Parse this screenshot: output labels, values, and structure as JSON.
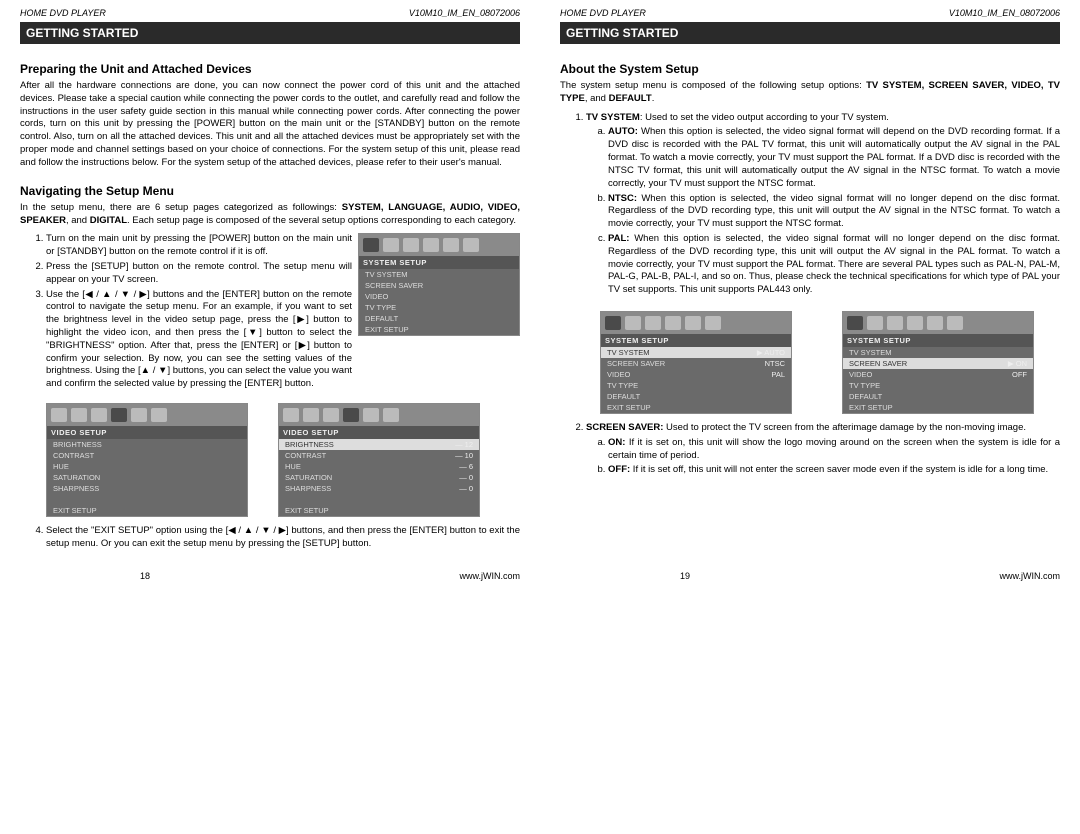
{
  "header": {
    "left": "HOME DVD PLAYER",
    "right": "V10M10_IM_EN_08072006"
  },
  "band": "GETTING STARTED",
  "footer": {
    "site": "www.jWIN.com"
  },
  "left": {
    "h1": "Preparing the Unit and Attached Devices",
    "p1": "After all the hardware connections are done, you can now connect the power cord of this unit and the attached devices. Please take a special caution while connecting the power cords to the outlet, and carefully read and follow the instructions in the user safety guide section in this manual while connecting power cords. After connecting the power cords, turn on this unit by pressing the [POWER] button on the main unit or the [STANDBY] button on the remote control. Also, turn on all the attached devices. This unit and all the attached devices must be appropriately set with the proper mode and channel settings based on your choice of connections. For the system setup of this unit, please read and follow the instructions below. For the system setup of the attached devices, please refer to their user's manual.",
    "h2": "Navigating the Setup Menu",
    "p2a": "In the setup menu, there are 6 setup pages categorized as followings: ",
    "p2b_bold": "SYSTEM, LANGUAGE, AUDIO, VIDEO, SPEAKER",
    "p2c": ", and ",
    "p2d_bold": "DIGITAL",
    "p2e": ". Each setup page is composed of the several setup options corresponding to each category.",
    "li1": "Turn on the main unit by pressing the [POWER] button on the main unit or [STANDBY] button on the remote control if it is off.",
    "li2": "Press the [SETUP] button on the remote control. The setup menu will appear on your TV screen.",
    "li3": "Use the [◀ / ▲ / ▼ / ▶] buttons and the [ENTER] button on the remote control to navigate the setup menu. For an example, if you want to set the brightness level in the video setup page, press the [▶] button to highlight the video icon, and then press the [▼] button to select the \"BRIGHTNESS\" option. After that, press the [ENTER] or [▶] button to confirm your selection. By now, you can see the setting values of the brightness. Using the [▲ / ▼] buttons, you can select the value you want and confirm the selected value by pressing the [ENTER] button.",
    "li4": "Select the \"EXIT SETUP\" option using the [◀ / ▲ / ▼ / ▶] buttons, and then press the [ENTER] button to exit the setup menu. Or you can exit the setup menu by pressing the [SETUP] button.",
    "pageno": "18",
    "shot_system": {
      "title": "SYSTEM SETUP",
      "rows": [
        "TV SYSTEM",
        "SCREEN SAVER",
        "VIDEO",
        "TV TYPE",
        "DEFAULT",
        "EXIT SETUP"
      ]
    },
    "shot_video1": {
      "title": "VIDEO SETUP",
      "rows": [
        "BRIGHTNESS",
        "CONTRAST",
        "HUE",
        "SATURATION",
        "SHARPNESS",
        "",
        "EXIT SETUP"
      ]
    },
    "shot_video2": {
      "title": "VIDEO SETUP",
      "rows": [
        {
          "l": "BRIGHTNESS",
          "v": "12"
        },
        {
          "l": "CONTRAST",
          "v": "10"
        },
        {
          "l": "HUE",
          "v": "6"
        },
        {
          "l": "SATURATION",
          "v": "0"
        },
        {
          "l": "SHARPNESS",
          "v": "0"
        },
        {
          "l": "",
          "v": ""
        },
        {
          "l": "EXIT SETUP",
          "v": ""
        }
      ]
    }
  },
  "right": {
    "h1": "About the System Setup",
    "p1a": "The system setup menu is composed of the following setup options: ",
    "p1b_bold": "TV SYSTEM, SCREEN SAVER, VIDEO, TV TYPE",
    "p1c": ", and ",
    "p1d_bold": "DEFAULT",
    "p1e": ".",
    "li1_lead": "TV SYSTEM",
    "li1_body": ": Used to set the video output according to your TV system.",
    "li1a_lead": "AUTO:",
    "li1a_body": " When this option is selected, the video signal format will depend on the DVD recording format. If a DVD disc is recorded with the PAL TV format, this unit will automatically output the AV signal in the PAL format. To watch a movie correctly, your TV must support the PAL format. If a DVD disc is recorded with the NTSC TV format, this unit will automatically output the AV signal in the NTSC format. To watch a movie correctly, your TV must support the NTSC format.",
    "li1b_lead": "NTSC:",
    "li1b_body": " When this option is selected, the video signal format will no longer depend on the disc format. Regardless of the DVD recording type, this unit will output the AV signal in the NTSC format. To watch a movie correctly, your TV must support the NTSC format.",
    "li1c_lead": "PAL:",
    "li1c_body": " When this option is selected, the video signal format will no longer depend on the disc format. Regardless of the DVD recording type, this unit will output the AV signal in the PAL format. To watch a movie correctly, your TV must support the PAL format. There are several PAL types such as PAL-N, PAL-M, PAL-G, PAL-B, PAL-I, and so on. Thus, please check the technical specifications for which type of PAL your TV set supports. This unit supports PAL443 only.",
    "li2_lead": "SCREEN SAVER:",
    "li2_body": " Used to protect the TV screen from the afterimage damage by the non-moving image.",
    "li2a_lead": "ON:",
    "li2a_body": " If it is set on, this unit will show the logo moving around on the screen when the system is idle for a certain time of period.",
    "li2b_lead": "OFF:",
    "li2b_body": " If it is set off, this unit will not enter the screen saver mode even if the system is idle for a long time.",
    "pageno": "19",
    "shotA": {
      "title": "SYSTEM SETUP",
      "rows": [
        {
          "l": "TV SYSTEM",
          "v": "AUTO",
          "hi": true
        },
        {
          "l": "SCREEN SAVER",
          "v": "NTSC"
        },
        {
          "l": "VIDEO",
          "v": "PAL"
        },
        {
          "l": "TV TYPE",
          "v": ""
        },
        {
          "l": "DEFAULT",
          "v": ""
        },
        {
          "l": "EXIT SETUP",
          "v": ""
        }
      ]
    },
    "shotB": {
      "title": "SYSTEM SETUP",
      "rows": [
        {
          "l": "TV SYSTEM",
          "v": ""
        },
        {
          "l": "SCREEN SAVER",
          "v": "ON",
          "hi": true
        },
        {
          "l": "VIDEO",
          "v": "OFF"
        },
        {
          "l": "TV TYPE",
          "v": ""
        },
        {
          "l": "DEFAULT",
          "v": ""
        },
        {
          "l": "EXIT SETUP",
          "v": ""
        }
      ]
    }
  }
}
